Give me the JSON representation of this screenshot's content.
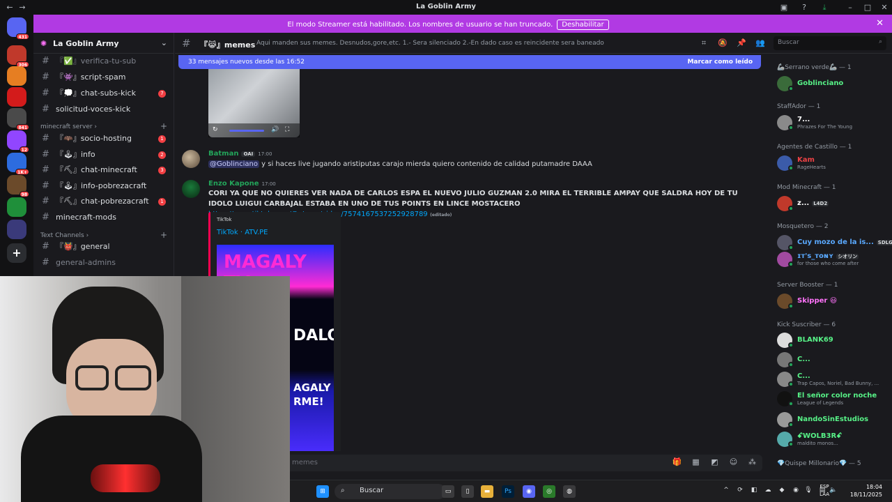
{
  "window": {
    "title": "La Goblin Army"
  },
  "banner": {
    "text": "El modo Streamer está habilitado. Los nombres de usuario se han truncado.",
    "button": "Deshabilitar"
  },
  "servers": [
    {
      "badge": "431",
      "color": "#5865f2"
    },
    {
      "badge": "306",
      "color": "#c0392b"
    },
    {
      "badge": "",
      "color": "#e67e22"
    },
    {
      "badge": "",
      "color": "#d31b1b"
    },
    {
      "badge": "841",
      "color": "#4a4a4a"
    },
    {
      "badge": "12",
      "color": "#9146ff"
    },
    {
      "badge": "1K+",
      "color": "#2d6cdf"
    },
    {
      "badge": "98",
      "color": "#6b4a2a"
    },
    {
      "badge": "",
      "color": "#1f8f3a"
    },
    {
      "badge": "",
      "color": "#3a3a7a"
    }
  ],
  "sidebar": {
    "server_name": "La Goblin Army",
    "channels_top": [
      {
        "label": "『✅』verifica-tu-sub",
        "badge": "",
        "dim": true
      },
      {
        "label": "『👾』script-spam",
        "badge": ""
      },
      {
        "label": "『💭』chat-subs-kick",
        "badge": "7"
      },
      {
        "label": "solicitud-voces-kick",
        "badge": ""
      }
    ],
    "category_minecraft": "minecraft server",
    "channels_mc": [
      {
        "label": "『🦇』socio-hosting",
        "badge": "1"
      },
      {
        "label": "『🕹』info",
        "badge": "2"
      },
      {
        "label": "『⛏』chat-minecraft",
        "badge": "3"
      },
      {
        "label": "『🕹』info-pobrezacraft",
        "badge": ""
      },
      {
        "label": "『⛏』chat-pobrezacraft",
        "badge": "1"
      },
      {
        "label": "minecraft-mods",
        "badge": ""
      }
    ],
    "category_text": "Text Channels",
    "channels_text": [
      {
        "label": "『👹』general",
        "badge": ""
      },
      {
        "label": "general-admins",
        "badge": "",
        "dim": true
      }
    ]
  },
  "chat_header": {
    "channel": "『😹』memes",
    "topic": "Aqui manden sus memes. Desnudos,gore,etc. 1.- Sera silenciado 2.-En dado caso es reincidente sera baneado",
    "search_placeholder": "Buscar"
  },
  "new_messages": {
    "text": "33 mensajes nuevos desde las 16:52",
    "action": "Marcar como leído"
  },
  "messages": [
    {
      "author": "Batman",
      "tag": "OAI",
      "time": "17:00",
      "color": "#23a55a",
      "mention": "@Goblinciano",
      "text": " y si haces live jugando aristiputas carajo mierda quiero contenido de calidad putamadre DAAA"
    },
    {
      "author": "Enzo Kapone",
      "time": "17:00",
      "color": "#23a55a",
      "text": "CORI YA QUE NO QUIERES VER NADA DE CARLOS ESPA EL NUEVO JULIO GUZMAN 2.0 MIRA EL TERRIBLE AMPAY QUE SALDRA HOY DE TU IDOLO LUIGUI CARBAJAL ESTABA EN UNO DE TUS POINTS EN LINCE MOSTACERO ",
      "link": "https://www.tiktok.com/@atv.pe/video/7574167537252928789",
      "edited": "(editado)",
      "embed_provider": "TikTok",
      "embed_title": "TikTok · ATV.PE"
    }
  ],
  "embed_image_text": [
    "MAGALY TV",
    "DALO",
    "AGALY",
    "RME!"
  ],
  "input": {
    "placeholder": "memes"
  },
  "members": {
    "roles": [
      {
        "name": "🦾Serrano verde🦾 — 1"
      },
      {
        "name": "StaffAdor — 1"
      },
      {
        "name": "Agentes de Castillo — 1"
      },
      {
        "name": "Mod Minecraft — 1"
      },
      {
        "name": "Mosquetero — 2"
      },
      {
        "name": "Server Booster — 1"
      },
      {
        "name": "Kick Suscriber — 6"
      },
      {
        "name": "💎Quispe Millonario💎 — 5"
      }
    ],
    "list": [
      {
        "name": "Goblinciano",
        "status": "",
        "color": "#57f287"
      },
      {
        "name": "7...",
        "status": "Phrazes For The Young",
        "color": "#ffffff"
      },
      {
        "name": "Kam",
        "status": "RageHearts",
        "color": "#ed4245"
      },
      {
        "name": "z...",
        "status": "",
        "tag": "L4D2",
        "color": "#ffffff"
      },
      {
        "name": "Cuy mozo de la is...",
        "status": "",
        "tag": "SDLG",
        "color": "#5aa9ff"
      },
      {
        "name": "ɪᴛ's_ᴛᴏɴʏ",
        "status": "for those who come after",
        "tag": "シオリン",
        "color": "#5aa9ff"
      },
      {
        "name": "Skipper 😃",
        "status": "",
        "color": "#ff73fa"
      },
      {
        "name": "BLANK69",
        "status": "",
        "color": "#57f287"
      },
      {
        "name": "C...",
        "status": "",
        "color": "#57f287"
      },
      {
        "name": "C...",
        "status": "Trap Capos, Noriel, Bad Bunny, ...",
        "color": "#57f287"
      },
      {
        "name": "El señor color noche",
        "status": "League of Legends",
        "color": "#57f287"
      },
      {
        "name": "NandoSinEstudios",
        "status": "",
        "color": "#57f287"
      },
      {
        "name": "ꗃWOLB3Rꗃ",
        "status": "maldito monos...",
        "color": "#57f287"
      }
    ]
  },
  "taskbar": {
    "search": "Buscar",
    "lang_top": "ESP",
    "lang_bottom": "LAA",
    "time": "18:04",
    "date": "18/11/2025"
  }
}
